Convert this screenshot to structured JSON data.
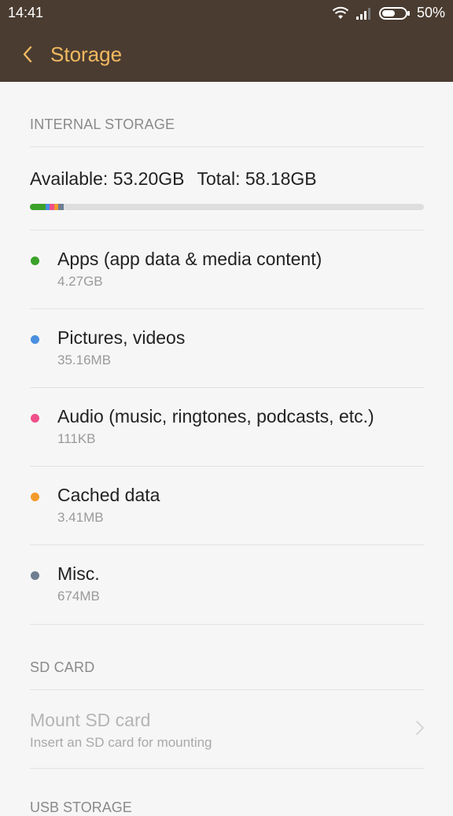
{
  "status": {
    "time": "14:41",
    "battery": "50%",
    "icons": [
      "wifi-icon",
      "signal-icon",
      "battery-icon"
    ]
  },
  "header": {
    "title": "Storage",
    "back_icon": "chevron-left-icon"
  },
  "internal": {
    "section_label": "INTERNAL STORAGE",
    "available": "Available: 53.20GB",
    "total": "Total: 58.18GB",
    "usage_fraction": 0.085,
    "items": [
      {
        "label": "Apps (app data & media content)",
        "value": "4.27GB",
        "color": "#3ba12a"
      },
      {
        "label": "Pictures, videos",
        "value": "35.16MB",
        "color": "#4a8fe0"
      },
      {
        "label": "Audio (music, ringtones, podcasts, etc.)",
        "value": "111KB",
        "color": "#ef4f8a"
      },
      {
        "label": "Cached data",
        "value": "3.41MB",
        "color": "#f39a2c"
      },
      {
        "label": "Misc.",
        "value": "674MB",
        "color": "#6e7f92"
      }
    ]
  },
  "sd": {
    "section_label": "SD CARD",
    "mount_title": "Mount SD card",
    "mount_sub": "Insert an SD card for mounting"
  },
  "usb": {
    "section_label": "USB STORAGE"
  }
}
